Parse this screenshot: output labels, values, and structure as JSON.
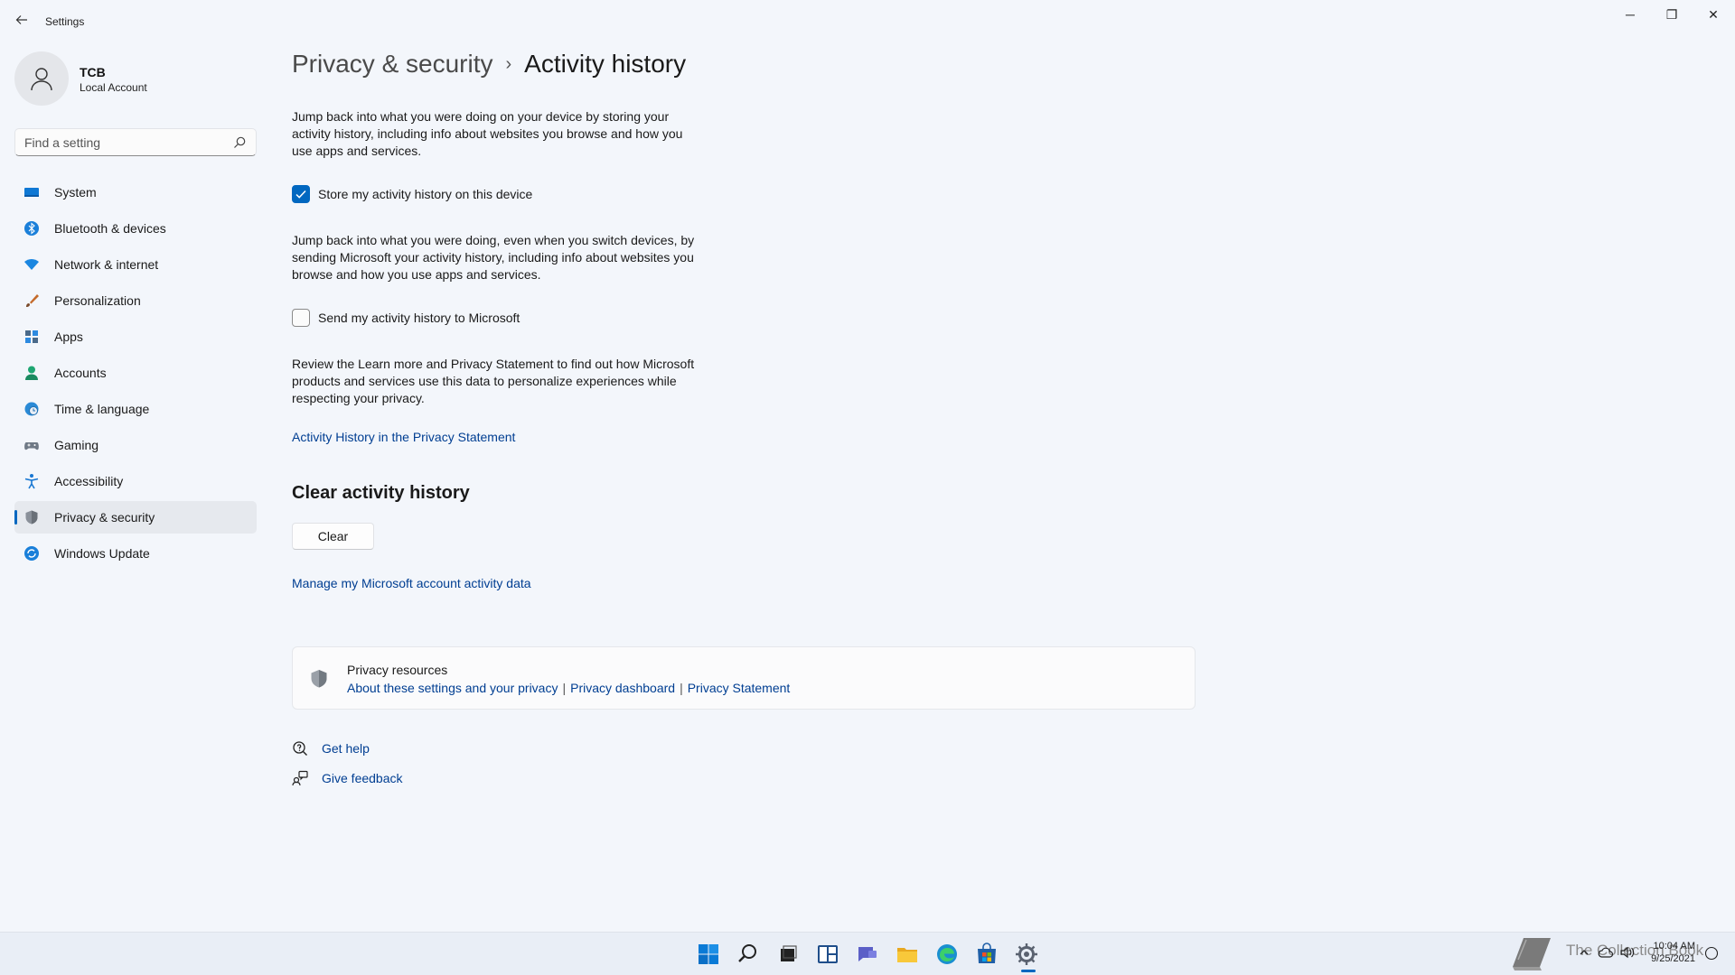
{
  "window": {
    "title": "Settings",
    "back_icon": "back-arrow-icon",
    "minimize": "─",
    "maximize": "❐",
    "close": "✕"
  },
  "profile": {
    "name": "TCB",
    "account_type": "Local Account"
  },
  "search": {
    "placeholder": "Find a setting"
  },
  "sidebar": {
    "items": [
      {
        "label": "System",
        "icon": "system-icon"
      },
      {
        "label": "Bluetooth & devices",
        "icon": "bluetooth-icon"
      },
      {
        "label": "Network & internet",
        "icon": "network-icon"
      },
      {
        "label": "Personalization",
        "icon": "brush-icon"
      },
      {
        "label": "Apps",
        "icon": "apps-icon"
      },
      {
        "label": "Accounts",
        "icon": "accounts-icon"
      },
      {
        "label": "Time & language",
        "icon": "globe-clock-icon"
      },
      {
        "label": "Gaming",
        "icon": "gamepad-icon"
      },
      {
        "label": "Accessibility",
        "icon": "accessibility-icon"
      },
      {
        "label": "Privacy & security",
        "icon": "shield-icon",
        "active": true
      },
      {
        "label": "Windows Update",
        "icon": "update-icon"
      }
    ]
  },
  "breadcrumb": {
    "parent": "Privacy & security",
    "separator": "›",
    "current": "Activity history"
  },
  "main": {
    "intro_text": "Jump back into what you were doing on your device by storing your activity history, including info about websites you browse and how you use apps and services.",
    "store_checkbox": {
      "label": "Store my activity history on this device",
      "checked": true
    },
    "send_text": "Jump back into what you were doing, even when you switch devices, by sending Microsoft your activity history, including info about websites you browse and how you use apps and services.",
    "send_checkbox": {
      "label": "Send my activity history to Microsoft",
      "checked": false
    },
    "review_text": "Review the Learn more and Privacy Statement to find out how Microsoft products and services use this data to personalize experiences while respecting your privacy.",
    "privacy_link": "Activity History in the Privacy Statement",
    "clear_section_title": "Clear activity history",
    "clear_button": "Clear",
    "manage_link": "Manage my Microsoft account activity data"
  },
  "privacy_resources": {
    "title": "Privacy resources",
    "links": [
      "About these settings and your privacy",
      "Privacy dashboard",
      "Privacy Statement"
    ],
    "separator": "|"
  },
  "help": {
    "get_help": "Get help",
    "give_feedback": "Give feedback"
  },
  "taskbar": {
    "icons": [
      "windows-start-icon",
      "search-icon",
      "task-view-icon",
      "widgets-icon",
      "chat-icon",
      "file-explorer-icon",
      "edge-icon",
      "store-icon",
      "settings-icon"
    ],
    "time": "10:04 AM",
    "date": "9/25/2021",
    "watermark": "The Collection Book"
  },
  "colors": {
    "accent": "#0067c0",
    "link": "#003e92",
    "background": "#f3f6fb"
  }
}
